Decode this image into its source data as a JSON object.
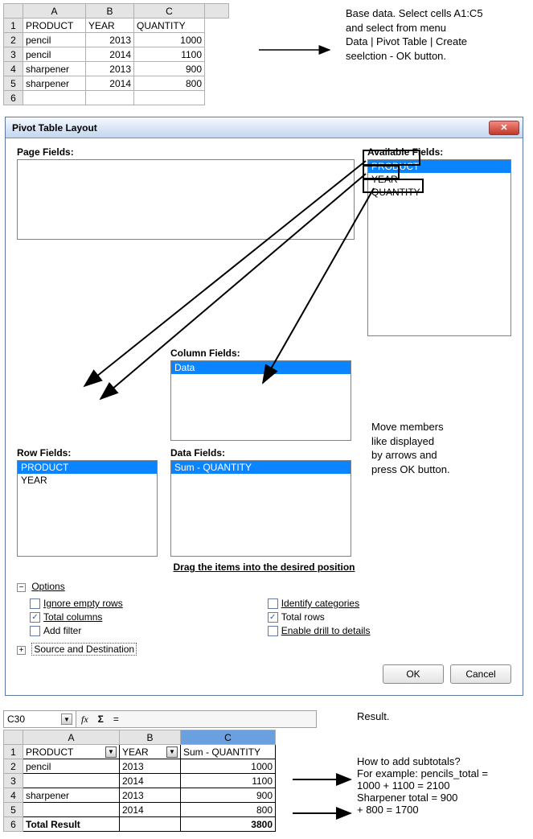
{
  "top_sheet": {
    "col_headers": [
      "A",
      "B",
      "C",
      ""
    ],
    "rows": [
      {
        "n": "1",
        "a": "PRODUCT",
        "b": "YEAR",
        "c": "QUANTITY"
      },
      {
        "n": "2",
        "a": "pencil",
        "b": "2013",
        "c": "1000"
      },
      {
        "n": "3",
        "a": "pencil",
        "b": "2014",
        "c": "1100"
      },
      {
        "n": "4",
        "a": "sharpener",
        "b": "2013",
        "c": "900"
      },
      {
        "n": "5",
        "a": "sharpener",
        "b": "2014",
        "c": "800"
      },
      {
        "n": "6",
        "a": "",
        "b": "",
        "c": ""
      }
    ]
  },
  "note1": {
    "l1": "Base data. Select cells A1:C5",
    "l2": "and select from menu",
    "l3": "Data | Pivot Table | Create",
    "l4": "seelction -  OK button."
  },
  "dialog": {
    "title": "Pivot Table Layout",
    "pagefields_label": "Page Fields:",
    "available_label": "Available Fields:",
    "available_items": [
      "PRODUCT",
      "YEAR",
      "QUANTITY"
    ],
    "colfields_label": "Column Fields:",
    "colfields_items": [
      "Data"
    ],
    "rowfields_label": "Row Fields:",
    "rowfields_items": [
      "PRODUCT",
      "YEAR"
    ],
    "datafields_label": "Data Fields:",
    "datafields_items": [
      "Sum - QUANTITY"
    ],
    "drag_hint": "Drag the items into the desired position",
    "options_label": "Options",
    "opts": {
      "ignore_empty": "Ignore empty rows",
      "total_cols": "Total columns",
      "add_filter": "Add filter",
      "identify": "Identify categories",
      "total_rows": "Total rows",
      "enable_drill": "Enable drill to details"
    },
    "opts_checked": {
      "total_cols": true,
      "total_rows": true
    },
    "source_dest": "Source and Destination",
    "ok": "OK",
    "cancel": "Cancel"
  },
  "note2": {
    "l1": "Move members",
    "l2": "like displayed",
    "l3": "by arrows and",
    "l4": "press OK button."
  },
  "result": {
    "cellref": "C30",
    "headers": {
      "a": "PRODUCT",
      "b": "YEAR",
      "c": "Sum - QUANTITY"
    },
    "rows": [
      {
        "n": "2",
        "a": "pencil",
        "b": "2013",
        "c": "1000"
      },
      {
        "n": "3",
        "a": "",
        "b": "2014",
        "c": "1100"
      },
      {
        "n": "4",
        "a": "sharpener",
        "b": "2013",
        "c": "900"
      },
      {
        "n": "5",
        "a": "",
        "b": "2014",
        "c": "800"
      }
    ],
    "total": {
      "n": "6",
      "a": "Total Result",
      "b": "",
      "c": "3800"
    }
  },
  "note3": {
    "result": "Result.",
    "q": "How to add subtotals?",
    "ex": "For example: pencils_total =",
    "ex2": "1000 + 1100 = 2100",
    "sh": "Sharpener total = 900",
    "sh2": "+ 800 = 1700"
  },
  "check": "✓",
  "fx_label": "fx",
  "sigma": "Σ",
  "equals": "="
}
